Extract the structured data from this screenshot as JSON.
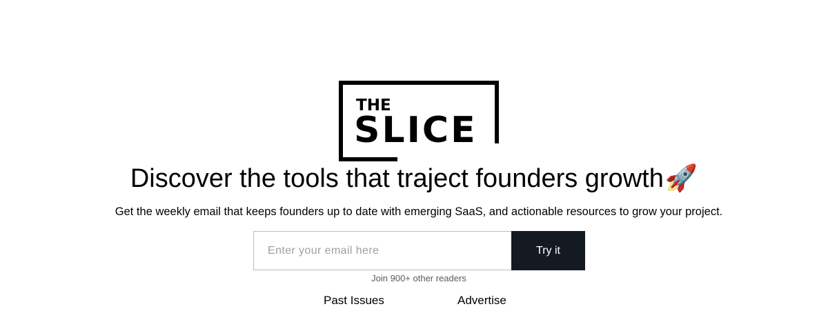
{
  "logo": {
    "line1": "THE",
    "line2": "SLICE"
  },
  "hero": {
    "headline": "Discover the tools that traject founders growth",
    "headline_emoji": "🚀",
    "subheadline": "Get the weekly email that keeps founders up to date with emerging SaaS, and actionable resources to grow your project."
  },
  "signup": {
    "email_placeholder": "Enter your email here",
    "email_value": "",
    "submit_label": "Try it",
    "readers_note": "Join 900+ other readers"
  },
  "nav": {
    "past_issues": "Past Issues",
    "advertise": "Advertise"
  },
  "colors": {
    "button_bg": "#141a22",
    "button_text": "#ffffff",
    "input_border": "#b9bcc1",
    "text": "#000000",
    "muted_text": "#555a60"
  }
}
